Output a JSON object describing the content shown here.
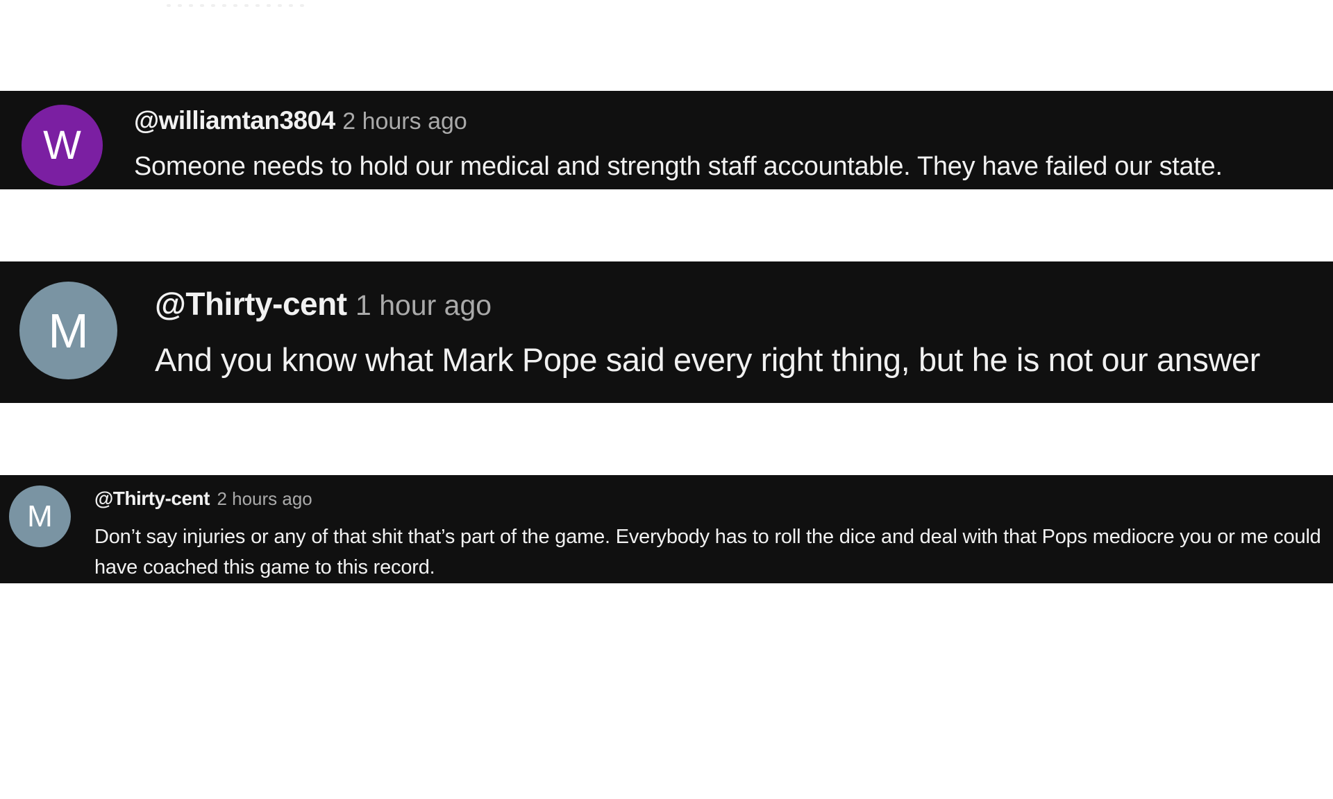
{
  "colors": {
    "comment_background": "#101010",
    "text_primary": "#f1f1f1",
    "text_secondary": "#aaaaaa",
    "page_background": "#ffffff"
  },
  "comments": [
    {
      "avatar_letter": "W",
      "avatar_color": "#7b1fa2",
      "handle": "@williamtan3804",
      "time": "2 hours ago",
      "text": "Someone needs to hold our medical and strength staff accountable. They have failed our state."
    },
    {
      "avatar_letter": "M",
      "avatar_color": "#7a94a3",
      "handle": "@Thirty-cent",
      "time": "1 hour ago",
      "text": "And you know what Mark Pope said every right thing, but he is not our answer"
    },
    {
      "avatar_letter": "M",
      "avatar_color": "#7a94a3",
      "handle": "@Thirty-cent",
      "time": "2 hours ago",
      "text": "Don’t say injuries or any of that shit that’s part of the game. Everybody has to roll the dice and deal with that Pops mediocre you or me could have coached this game to this record."
    }
  ]
}
